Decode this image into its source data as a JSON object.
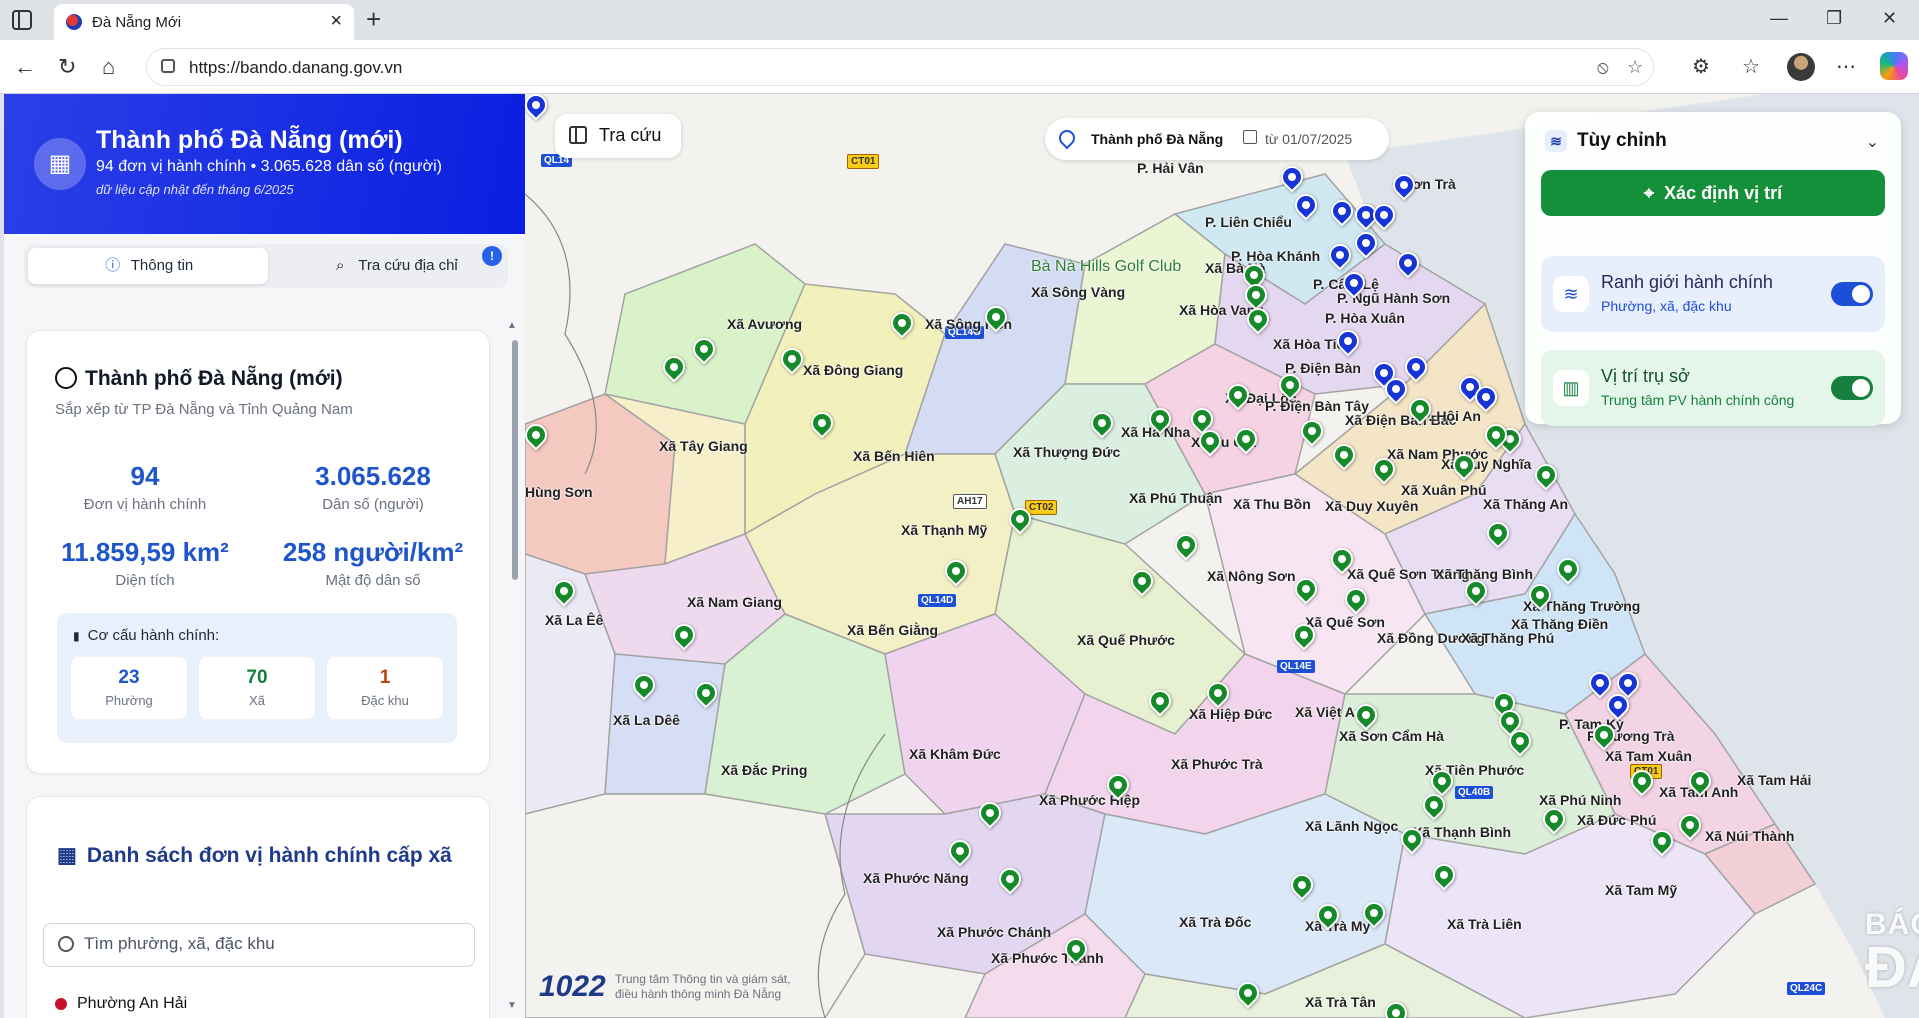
{
  "browser": {
    "tab_title": "Đà Nẵng Mới",
    "url": "https://bando.danang.gov.vn"
  },
  "sidebar": {
    "title": "Thành phố Đà Nẵng (mới)",
    "subtitle": "94 đơn vị hành chính • 3.065.628 dân số (người)",
    "note": "dữ liệu cập nhật đến tháng 6/2025",
    "tabs": [
      {
        "label": "Thông tin"
      },
      {
        "label": "Tra cứu địa chỉ"
      }
    ],
    "tab_badge": "!",
    "info_card": {
      "title": "Thành phố Đà Nẵng (mới)",
      "subtitle": "Sắp xếp từ TP Đà Nẵng và Tỉnh Quảng Nam",
      "stats": [
        {
          "value": "94",
          "label": "Đơn vị hành chính"
        },
        {
          "value": "3.065.628",
          "label": "Dân số (người)"
        },
        {
          "value": "11.859,59 km²",
          "label": "Diện tích"
        },
        {
          "value": "258 người/km²",
          "label": "Mật độ dân số"
        }
      ],
      "structure_title": "Cơ cấu hành chính:",
      "structure": [
        {
          "value": "23",
          "label": "Phường",
          "color": "#1e56c9"
        },
        {
          "value": "70",
          "label": "Xã",
          "color": "#15803d"
        },
        {
          "value": "1",
          "label": "Đặc khu",
          "color": "#c2410c"
        }
      ]
    },
    "list_card": {
      "title": "Danh sách đơn vị hành chính cấp xã",
      "search_placeholder": "Tìm phường, xã, đặc khu",
      "first_item": "Phường An Hải"
    }
  },
  "map": {
    "tracuu_label": "Tra cứu",
    "location_city": "Thành phố Đà Nẵng",
    "location_date": "từ 01/07/2025",
    "panel": {
      "title": "Tùy chỉnh",
      "locate_button": "Xác định vị trí",
      "layers": [
        {
          "title": "Ranh giới hành chính",
          "subtitle": "Phường, xã, đặc khu",
          "enabled": true
        },
        {
          "title": "Vị trí trụ sở",
          "subtitle": "Trung tâm PV hành chính công",
          "enabled": true
        }
      ]
    },
    "logo_text": "1022",
    "logo_caption_line1": "Trung tâm Thông tin và giám sát,",
    "logo_caption_line2": "điều hành thông minh Đà Nẵng",
    "watermark_top": "BÁO",
    "watermark_bottom": "ĐÀNẴNG",
    "labels": [
      "Xã Avương",
      "Xã Sông Kôn",
      "Xã Sông Vàng",
      "Xã Đông Giang",
      "Xã Tây Giang",
      "Xã Bến Hiên",
      "Xã Thượng Đức",
      "Xã Hà Nha",
      "Xã Vu Gia",
      "Xã Đại Lộc",
      "Xã Hòa Vang",
      "Xã Hòa Tiến",
      "Xã Bà Nà",
      "P. Liên Chiểu",
      "P. Hòa Khánh",
      "P. Cẩm Lệ",
      "P. Ngũ Hành Sơn",
      "P. Hòa Xuân",
      "P. Hải Vân",
      "Sơn Trà",
      "P. Điện Bàn",
      "P. Điện Bàn Tây",
      "Xã Điện Bàn Bắc",
      "P. Hội An",
      "Xã Nam Phước",
      "Xã Duy Nghĩa",
      "Xã Xuân Phú",
      "Xã Thăng An",
      "Xã Phú Thuận",
      "Xã Thu Bồn",
      "Xã Duy Xuyên",
      "Xã Thạnh Mỹ",
      "Xã Nông Sơn",
      "Xã Quế Sơn Trung",
      "Xã Thăng Bình",
      "Xã Thăng Trường",
      "Xã Thăng Điền",
      "Xã Quế Sơn",
      "Xã Đồng Dương",
      "Xã Thăng Phú",
      "Xã Nam Giang",
      "Xã Bến Giằng",
      "Xã Quế Phước",
      "Xã La Êê",
      "Xã La Dêê",
      "Xã Đắc Pring",
      "Xã Hiệp Đức",
      "Xã Việt An",
      "Xã Sơn Cẩm Hà",
      "Xã Phước Trà",
      "Xã Khâm Đức",
      "Xã Phước Hiệp",
      "Xã Lãnh Ngọc",
      "Xã Thạnh Bình",
      "Xã Tiên Phước",
      "P. Tam Kỳ",
      "P. Hương Trà",
      "Xã Tam Xuân",
      "Xã Tam Hải",
      "Xã Tam Anh",
      "Xã Phú Ninh",
      "Xã Đức Phú",
      "Xã Núi Thành",
      "Xã Tam Mỹ",
      "Xã Phước Năng",
      "Xã Phước Chánh",
      "Xã Phước Thành",
      "Xã Trà Đốc",
      "Xã Trà My",
      "Xã Trà Liên",
      "Xã Trà Tân",
      "Hùng Sơn",
      "Bà Nà Hills Golf Club"
    ],
    "roads": [
      "QL14",
      "CT01",
      "QL14G",
      "AH17",
      "CT02",
      "QL14D",
      "QL14E",
      "QL40B",
      "QL24C",
      "CT01"
    ]
  }
}
